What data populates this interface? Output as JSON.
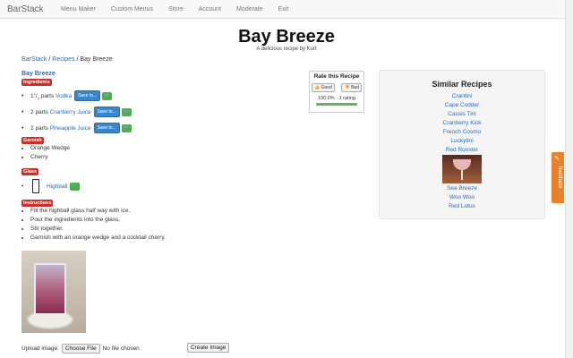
{
  "nav": {
    "brand": "BarStack",
    "items": [
      "Menu Maker",
      "Custom Menus",
      "Store",
      "Account",
      "Moderate",
      "Exit"
    ]
  },
  "page": {
    "title": "Bay Breeze",
    "subtitle": "A delicious recipe by Kurt"
  },
  "breadcrumb": {
    "root": "BarStack",
    "sep": "/",
    "section": "Recipes",
    "current": "/ Bay Breeze"
  },
  "recipe": {
    "name": "Bay Breeze",
    "ingredients_label": "Ingredients",
    "save_label": "Save to...",
    "ingredients": [
      {
        "amount_whole": "1",
        "amount_num": "1",
        "amount_den": "2",
        "unit": "parts",
        "name": "Vodka"
      },
      {
        "amount": "2",
        "unit": "parts",
        "name": "Cranberry Juice"
      },
      {
        "amount": "2",
        "unit": "parts",
        "name": "Pineapple Juice"
      }
    ],
    "garnish_label": "Garnish",
    "garnish": [
      "Orange Wedge",
      "Cherry"
    ],
    "glass_label": "Glass",
    "glass": "Highball",
    "instructions_label": "Instructions",
    "instructions": [
      "Fill the highball glass half way with ice.",
      "Pour the ingredients into the glass.",
      "Stir together.",
      "Garnish with an orange wedge and a cocktail cherry."
    ]
  },
  "upload": {
    "label": "Upload image:",
    "choose": "Choose File",
    "status": "No file chosen",
    "create": "Create Image"
  },
  "rating": {
    "title": "Rate this Recipe",
    "good": "Good",
    "bad": "Bad",
    "summary": "100.0% - 1 rating",
    "positive_fraction": 1.0
  },
  "similar": {
    "title": "Similar Recipes",
    "items_before": [
      "Crantini",
      "Cape Codder",
      "Cassis Tini",
      "Cranberry Kick",
      "French Cosmo",
      "Luckytini",
      "Red Rooster"
    ],
    "items_after": [
      "Sea Breeze",
      "Woo Woo",
      "Red Lotus"
    ]
  },
  "feedback": {
    "label": "feedback"
  },
  "colors": {
    "link": "#2a6bb5",
    "label_red": "#c9302c",
    "save_blue": "#3a87c8",
    "cart_green": "#4cae4c",
    "feedback_orange": "#e8812a"
  }
}
